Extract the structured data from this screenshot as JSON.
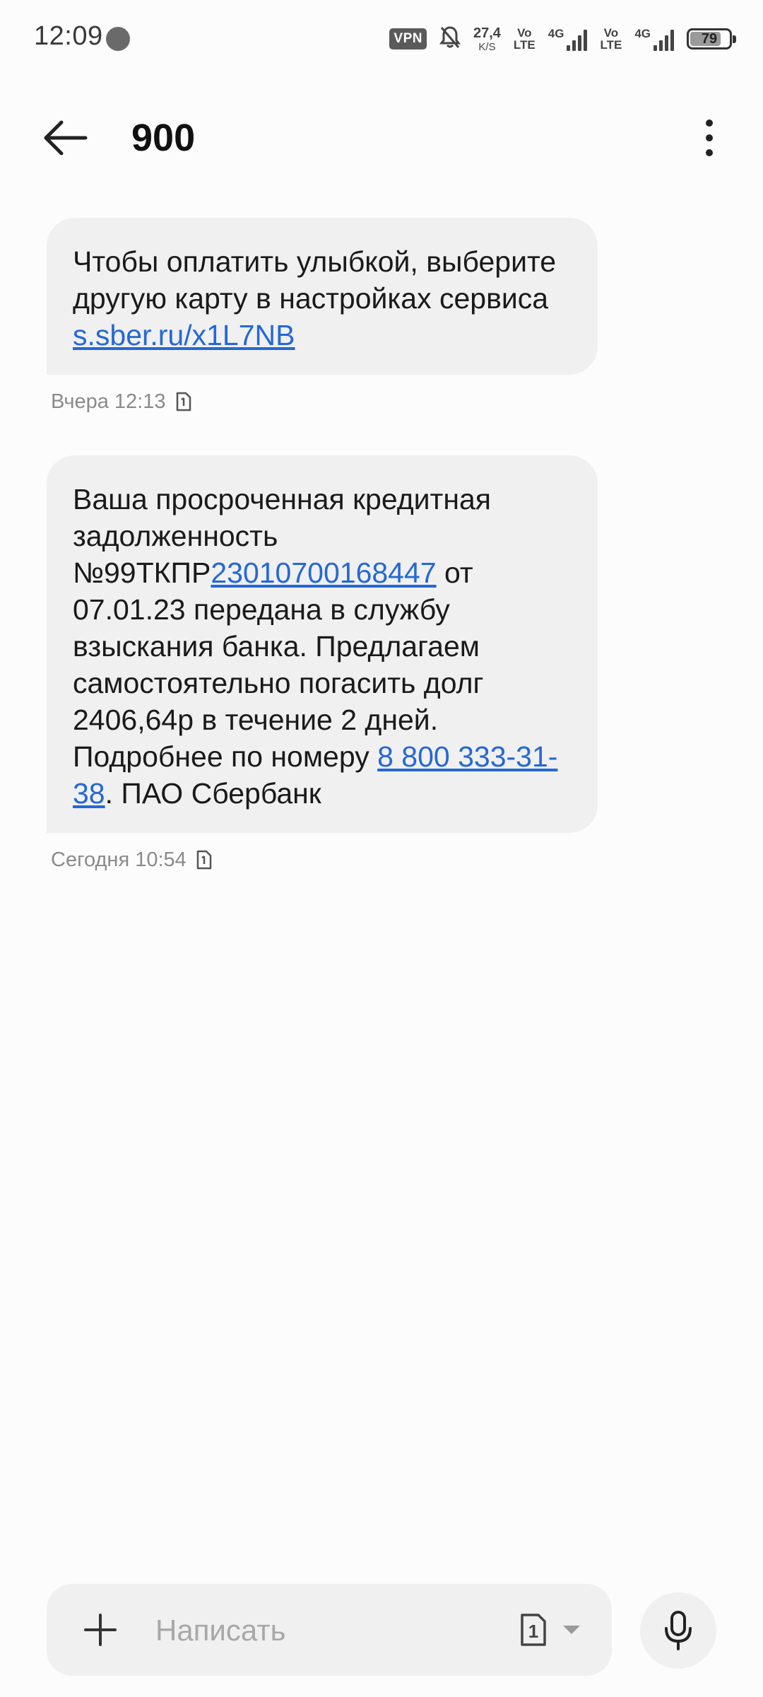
{
  "status_bar": {
    "time": "12:09",
    "vpn": "VPN",
    "speed_value": "27,4",
    "speed_unit": "K/S",
    "sim1_label_top": "Vo",
    "sim1_label_bottom": "LTE",
    "sim1_network": "4G",
    "sim2_label_top": "Vo",
    "sim2_label_bottom": "LTE",
    "sim2_network": "4G",
    "battery_level": "79",
    "battery_fraction": 0.79
  },
  "header": {
    "title": "900",
    "back_icon": "arrow-left-icon",
    "more_icon": "more-vertical-icon"
  },
  "messages": [
    {
      "text_before_link": "Чтобы оплатить улыбкой, выберите другую карту в настройках сервиса ",
      "link": "s.sber.ru/x1L7NB",
      "timestamp": "Вчера 12:13"
    },
    {
      "text_part1": "Ваша просроченная кредитная задолженность №99ТКПР",
      "link_number": "23010700168447",
      "text_part2": " от 07.01.23 передана в службу взыскания банка. Предлагаем самостоятельно погасить долг 2406,64р в течение 2 дней. Подробнее по номеру ",
      "link_phone": "8 800 333-31-38",
      "text_part3": ". ПАО Сбербанк",
      "timestamp": "Сегодня 10:54"
    }
  ],
  "composer": {
    "placeholder": "Написать",
    "sim_slot": "1"
  },
  "colors": {
    "link": "#2468d6",
    "bubble": "#f0f0f0",
    "background": "#fcfcfc"
  }
}
